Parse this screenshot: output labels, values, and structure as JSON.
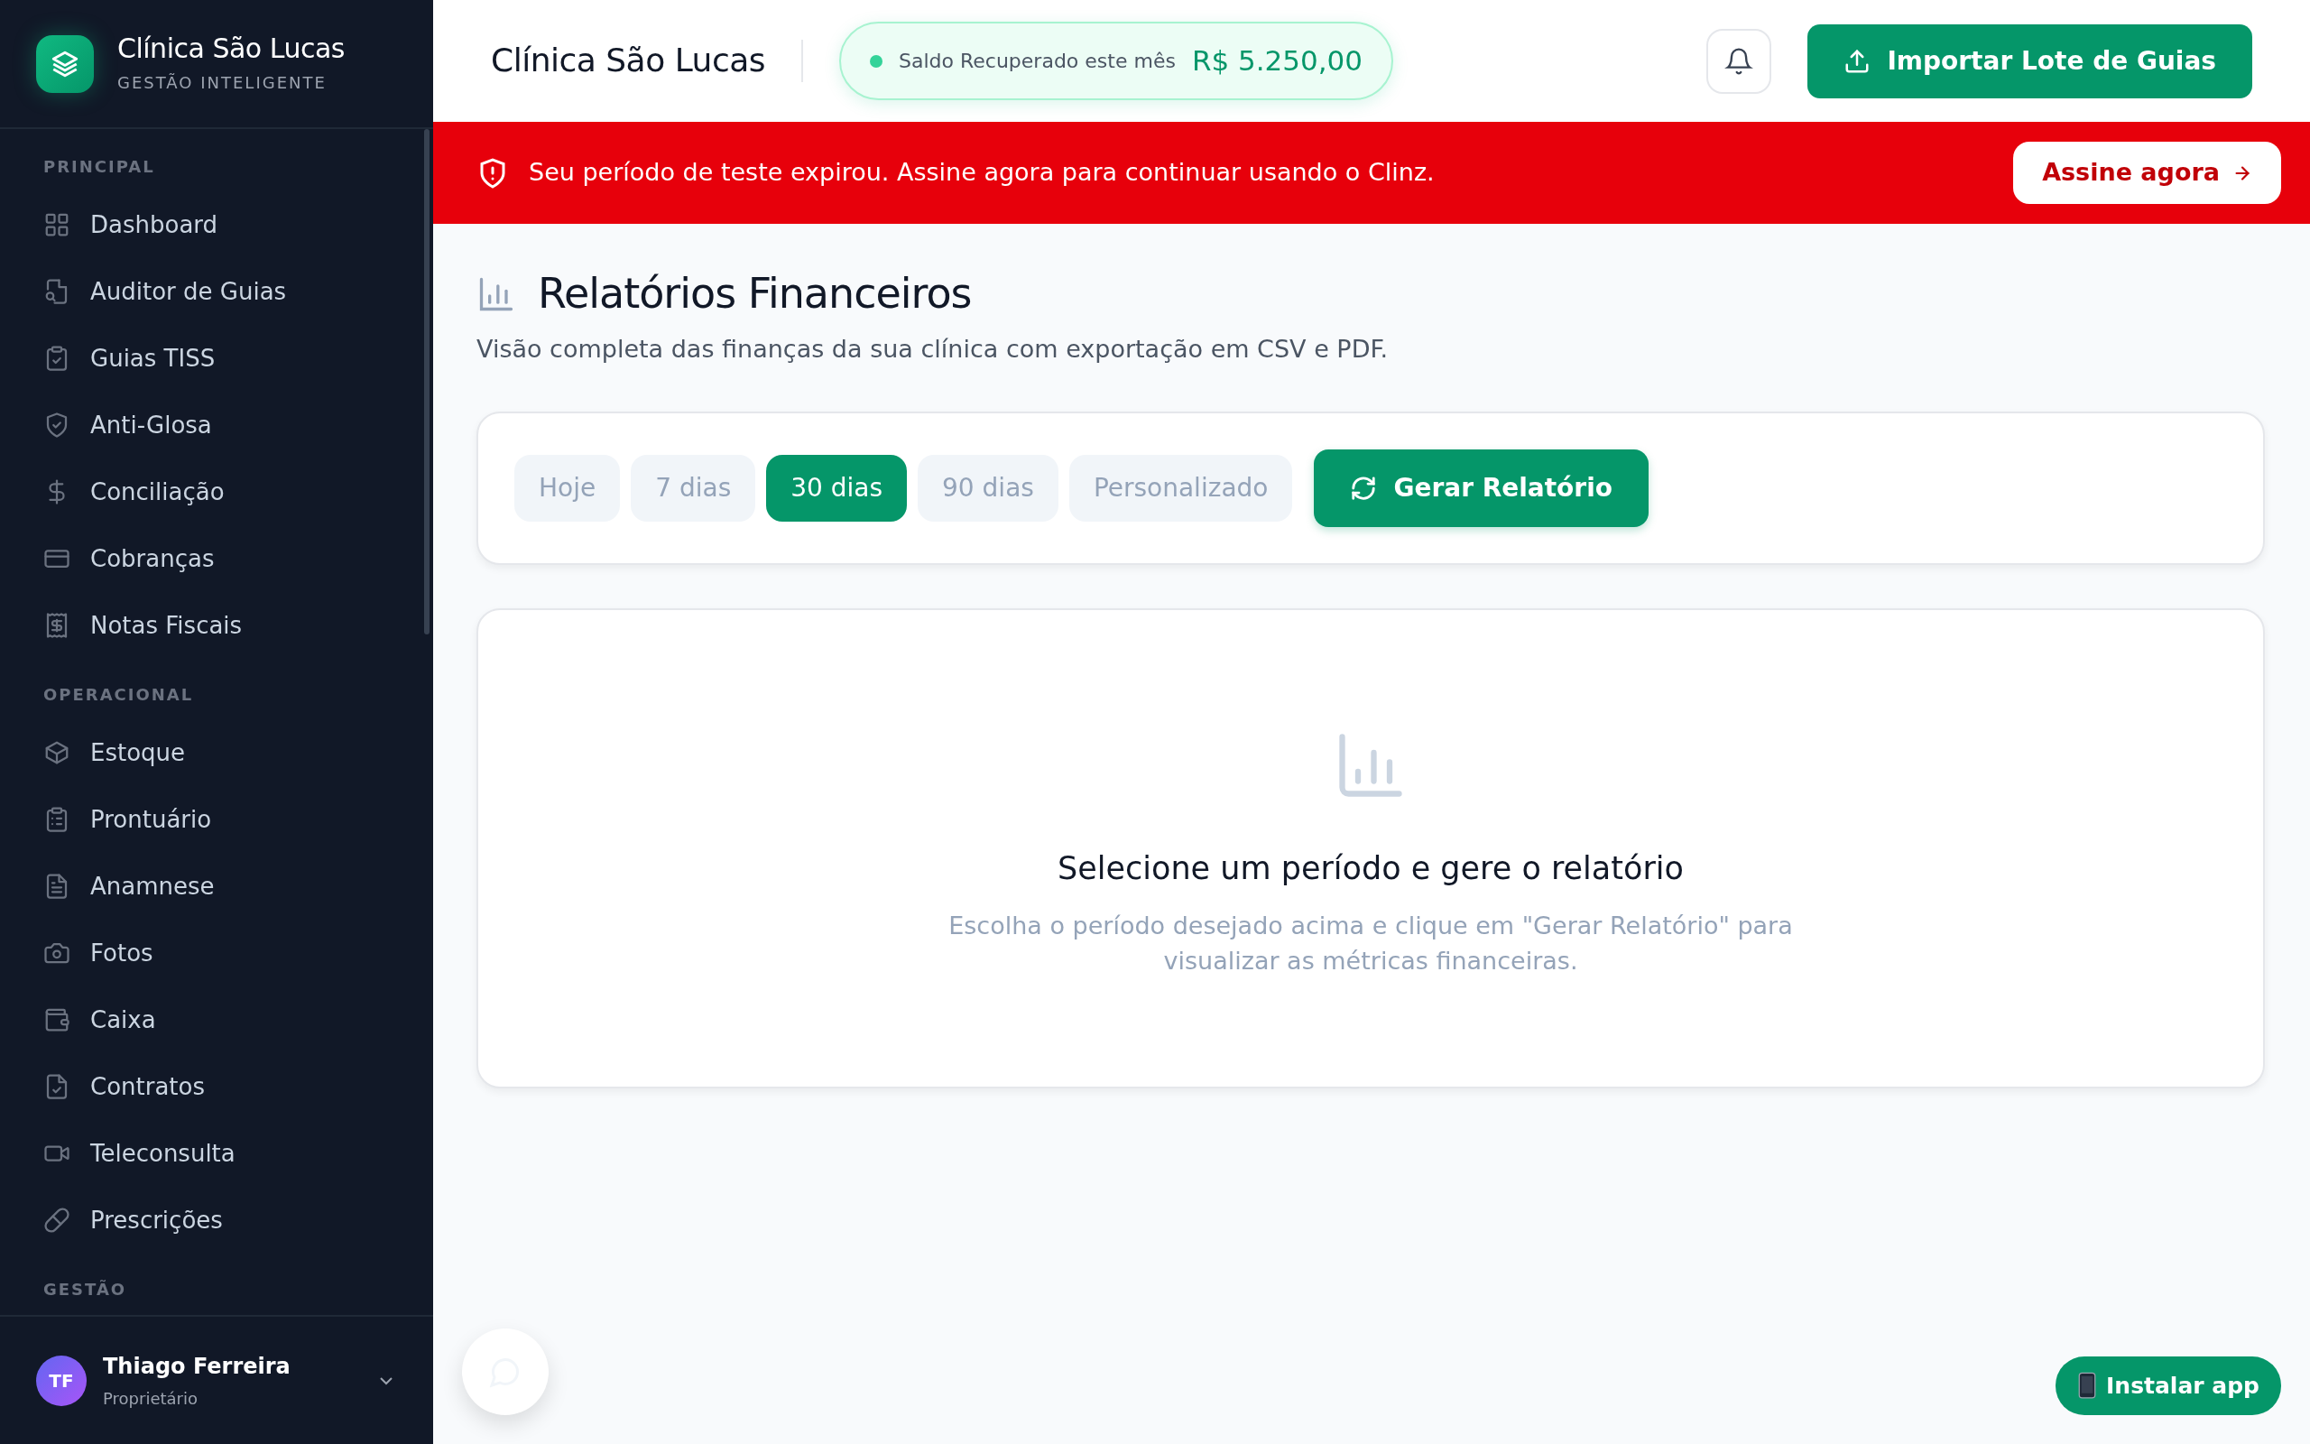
{
  "sidebar": {
    "brand": {
      "name": "Clínica São Lucas",
      "tagline": "GESTÃO INTELIGENTE"
    },
    "sections": [
      {
        "title": "PRINCIPAL",
        "items": [
          {
            "label": "Dashboard",
            "selected": false
          },
          {
            "label": "Auditor de Guias",
            "selected": false
          },
          {
            "label": "Guias TISS",
            "selected": false
          },
          {
            "label": "Anti-Glosa",
            "selected": false
          },
          {
            "label": "Conciliação",
            "selected": false
          },
          {
            "label": "Cobranças",
            "selected": false
          },
          {
            "label": "Notas Fiscais",
            "selected": false
          }
        ]
      },
      {
        "title": "OPERACIONAL",
        "items": [
          {
            "label": "Estoque",
            "selected": false
          },
          {
            "label": "Prontuário",
            "selected": false
          },
          {
            "label": "Anamnese",
            "selected": false
          },
          {
            "label": "Fotos",
            "selected": false
          },
          {
            "label": "Caixa",
            "selected": false
          },
          {
            "label": "Contratos",
            "selected": false
          },
          {
            "label": "Teleconsulta",
            "selected": false
          },
          {
            "label": "Prescrições",
            "selected": false
          }
        ]
      },
      {
        "title": "GESTÃO"
      }
    ],
    "user": {
      "initials": "TF",
      "name": "Thiago Ferreira",
      "role": "Proprietário"
    }
  },
  "header": {
    "clinic": "Clínica São Lucas",
    "recovered_label": "Saldo Recuperado este mês",
    "recovered_value": "R$ 5.250,00",
    "import_button": "Importar Lote de Guias"
  },
  "banner": {
    "message": "Seu período de teste expirou. Assine agora para continuar usando o Clinz.",
    "button": "Assine agora"
  },
  "page": {
    "title": "Relatórios Financeiros",
    "subtitle": "Visão completa das finanças da sua clínica com exportação em CSV e PDF.",
    "periods": [
      {
        "label": "Hoje",
        "selected": false
      },
      {
        "label": "7 dias",
        "selected": false
      },
      {
        "label": "30 dias",
        "selected": true
      },
      {
        "label": "90 dias",
        "selected": false
      },
      {
        "label": "Personalizado",
        "selected": false
      }
    ],
    "generate_button": "Gerar Relatório",
    "empty_state": {
      "title": "Selecione um período e gere o relatório",
      "text": "Escolha o período desejado acima e clique em \"Gerar Relatório\" para visualizar as métricas financeiras."
    }
  },
  "install_button": "Instalar app"
}
